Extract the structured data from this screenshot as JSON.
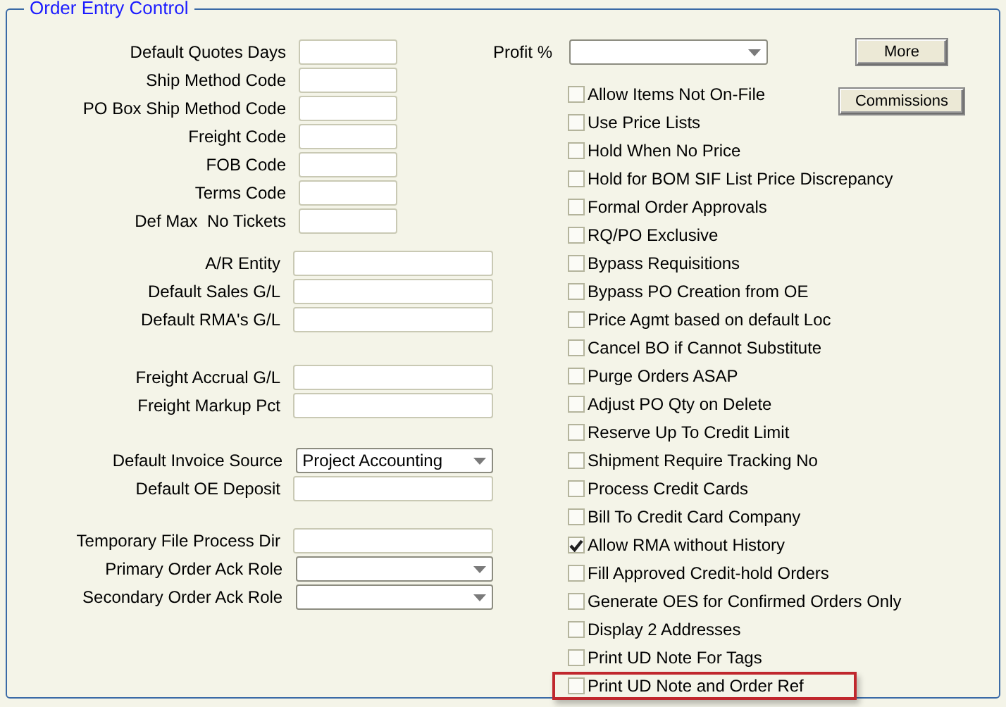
{
  "panel": {
    "title": "Order Entry Control"
  },
  "field_groups": [
    [
      {
        "label": "Default Quotes Days",
        "kind": "short_text"
      },
      {
        "label": "Ship Method Code",
        "kind": "short_text"
      },
      {
        "label": "PO Box Ship Method Code",
        "kind": "short_text"
      },
      {
        "label": "Freight Code",
        "kind": "short_text"
      },
      {
        "label": "FOB Code",
        "kind": "short_text"
      },
      {
        "label": "Terms Code",
        "kind": "short_text"
      },
      {
        "label": "Def Max  No Tickets",
        "kind": "short_text"
      }
    ],
    [
      {
        "label": "A/R Entity",
        "kind": "text"
      },
      {
        "label": "Default Sales G/L",
        "kind": "text"
      },
      {
        "label": "Default RMA's G/L",
        "kind": "text"
      }
    ],
    [
      {
        "label": "Freight Accrual G/L",
        "kind": "text"
      },
      {
        "label": "Freight Markup Pct",
        "kind": "text"
      }
    ],
    [
      {
        "label": "Default Invoice Source",
        "kind": "select",
        "value": "Project Accounting"
      },
      {
        "label": "Default OE Deposit",
        "kind": "text"
      }
    ],
    [
      {
        "label": "Temporary File Process Dir",
        "kind": "text"
      },
      {
        "label": "Primary Order Ack Role",
        "kind": "select"
      },
      {
        "label": "Secondary Order Ack Role",
        "kind": "select"
      }
    ]
  ],
  "profit": {
    "label": "Profit %"
  },
  "buttons": {
    "more": "More",
    "commissions": "Commissions"
  },
  "options": [
    {
      "label": "Allow Items Not On-File",
      "checked": false,
      "highlighted": false
    },
    {
      "label": "Use Price Lists",
      "checked": false,
      "highlighted": false
    },
    {
      "label": "Hold When No Price",
      "checked": false,
      "highlighted": false
    },
    {
      "label": "Hold for BOM SIF List Price Discrepancy",
      "checked": false,
      "highlighted": false
    },
    {
      "label": "Formal Order Approvals",
      "checked": false,
      "highlighted": false
    },
    {
      "label": "RQ/PO Exclusive",
      "checked": false,
      "highlighted": false
    },
    {
      "label": "Bypass Requisitions",
      "checked": false,
      "highlighted": false
    },
    {
      "label": "Bypass PO Creation from OE",
      "checked": false,
      "highlighted": false
    },
    {
      "label": "Price Agmt based on default Loc",
      "checked": false,
      "highlighted": false
    },
    {
      "label": "Cancel BO if Cannot Substitute",
      "checked": false,
      "highlighted": false
    },
    {
      "label": "Purge Orders ASAP",
      "checked": false,
      "highlighted": false
    },
    {
      "label": "Adjust PO Qty on Delete",
      "checked": false,
      "highlighted": false
    },
    {
      "label": "Reserve Up To Credit Limit",
      "checked": false,
      "highlighted": false
    },
    {
      "label": "Shipment Require Tracking No",
      "checked": false,
      "highlighted": false
    },
    {
      "label": "Process Credit Cards",
      "checked": false,
      "highlighted": false
    },
    {
      "label": "Bill To Credit Card Company",
      "checked": false,
      "highlighted": false
    },
    {
      "label": "Allow RMA without History",
      "checked": true,
      "highlighted": false
    },
    {
      "label": "Fill Approved Credit-hold Orders",
      "checked": false,
      "highlighted": false
    },
    {
      "label": "Generate OES for Confirmed Orders Only",
      "checked": false,
      "highlighted": false
    },
    {
      "label": "Display 2 Addresses",
      "checked": false,
      "highlighted": false
    },
    {
      "label": "Print UD Note For Tags",
      "checked": false,
      "highlighted": false
    },
    {
      "label": "Print UD Note and Order Ref",
      "checked": false,
      "highlighted": true
    }
  ]
}
